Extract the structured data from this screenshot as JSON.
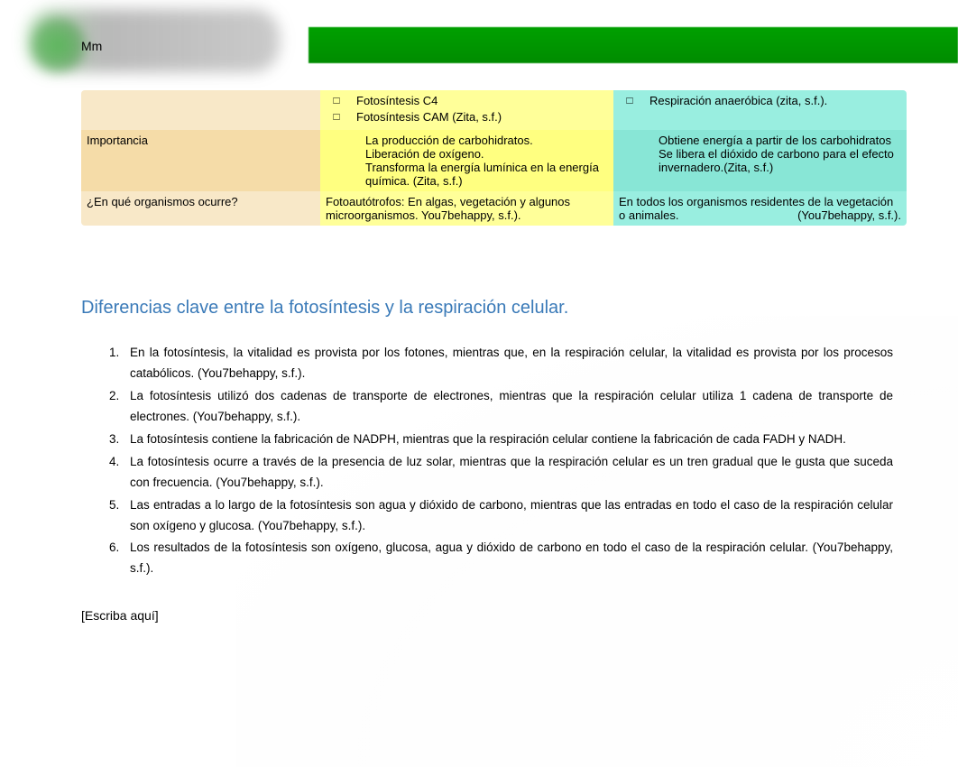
{
  "header": {
    "mm": "Mm"
  },
  "table": {
    "rows": [
      {
        "label": "",
        "colB_bullets": [
          "Fotosíntesis C4",
          "Fotosíntesis CAM (Zita, s.f.)"
        ],
        "colC_bullets": [
          "Respiración anaeróbica (zita, s.f.)."
        ]
      },
      {
        "label": "Importancia",
        "colB_lines": [
          "La producción de carbohidratos.",
          "Liberación de oxígeno.",
          "Transforma la energía lumínica en la energía química. (Zita, s.f.)"
        ],
        "colC_lines": [
          "Obtiene energía a partir de los carbohidratos",
          "Se libera el dióxido de carbono para el efecto invernadero.(Zita, s.f.)"
        ]
      },
      {
        "label": "¿En qué organismos ocurre?",
        "colB_text": "Fotoautótrofos: En algas, vegetación y algunos microorganismos. You7behappy, s.f.).",
        "colC_text": "En todos los organismos residentes de la vegetación o animales.",
        "colC_cite": "(You7behappy, s.f.)."
      }
    ]
  },
  "section": {
    "title": "Diferencias clave entre la fotosíntesis y la respiración celular.",
    "items": [
      "En la fotosíntesis, la vitalidad es provista por los fotones, mientras que, en la respiración celular, la vitalidad es provista por los procesos catabólicos. (You7behappy, s.f.).",
      "La fotosíntesis utilizó dos cadenas de transporte de electrones, mientras que la respiración celular utiliza 1 cadena de transporte de electrones. (You7behappy, s.f.).",
      "La fotosíntesis contiene la fabricación de NADPH, mientras que la respiración celular contiene la fabricación de cada FADH y NADH.",
      "La fotosíntesis ocurre a través de la presencia de luz solar, mientras que la respiración celular es un tren gradual que le gusta que suceda con frecuencia. (You7behappy, s.f.).",
      "Las entradas a lo largo de la fotosíntesis son agua y dióxido de carbono, mientras que las entradas en todo el caso de la respiración celular son oxígeno y glucosa. (You7behappy, s.f.).",
      "Los resultados de la fotosíntesis son oxígeno, glucosa, agua y dióxido de carbono en todo el caso de la respiración celular. (You7behappy, s.f.)."
    ]
  },
  "footer": {
    "placeholder": "[Escriba aquí]"
  }
}
